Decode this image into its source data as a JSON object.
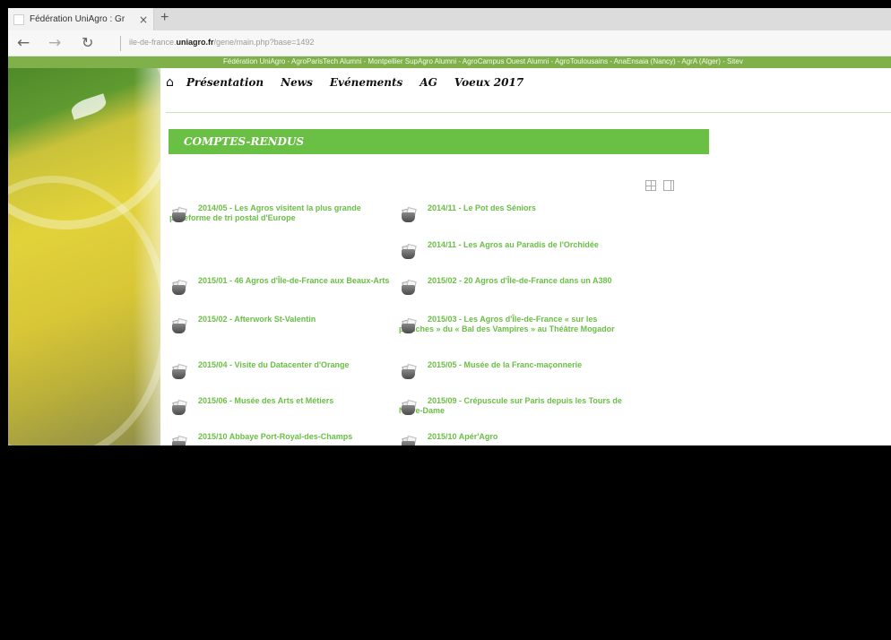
{
  "browser": {
    "tab_title": "Fédération UniAgro : Gr",
    "tab_close": "×",
    "new_tab": "+",
    "nav": {
      "back": "←",
      "forward": "→",
      "refresh": "↻"
    },
    "url_prefix": "ile-de-france.",
    "url_domain": "uniagro.fr",
    "url_path": "/gene/main.php?base=1492"
  },
  "page": {
    "top_links": "Fédération UniAgro  -  AgroParisTech Alumni  -  Montpellier SupAgro Alumni  -  AgroCampus Ouest Alumni  -  AgroToulousains  -  AnaEnsaia (Nancy)  -  AgrA (Alger)  -  Sitev",
    "home_icon": "⌂",
    "menu": [
      "Présentation",
      "News",
      "Evénements",
      "AG",
      "Voeux 2017"
    ],
    "section_title": "COMPTES-RENDUS",
    "items": [
      {
        "text": "2014/05 - Les Agros visitent la plus grande plateforme de tri postal d'Europe"
      },
      {
        "text": "2014/11 - Le Pot des Séniors"
      },
      {
        "text": "2014/11 - Les Agros au Paradis de l'Orchidée"
      },
      {
        "text": "2015/01 - 46 Agros d'Île-de-France aux Beaux-Arts"
      },
      {
        "text": "2015/02 - 20 Agros d'Île-de-France dans un A380"
      },
      {
        "text": "2015/02 - Afterwork St-Valentin"
      },
      {
        "text": "2015/03 - Les Agros d'Île-de-France « sur les planches » du « Bal des Vampires » au Théâtre Mogador"
      },
      {
        "text": "2015/04 - Visite du Datacenter d'Orange"
      },
      {
        "text": "2015/05 - Musée de la Franc-maçonnerie"
      },
      {
        "text": "2015/06 - Musée des Arts et Métiers"
      },
      {
        "text": "2015/09 - Crépuscule sur Paris depuis les Tours de Notre-Dame"
      },
      {
        "text": "2015/10 Abbaye Port-Royal-des-Champs"
      },
      {
        "text": "2015/10 Apér'Agro"
      }
    ]
  }
}
